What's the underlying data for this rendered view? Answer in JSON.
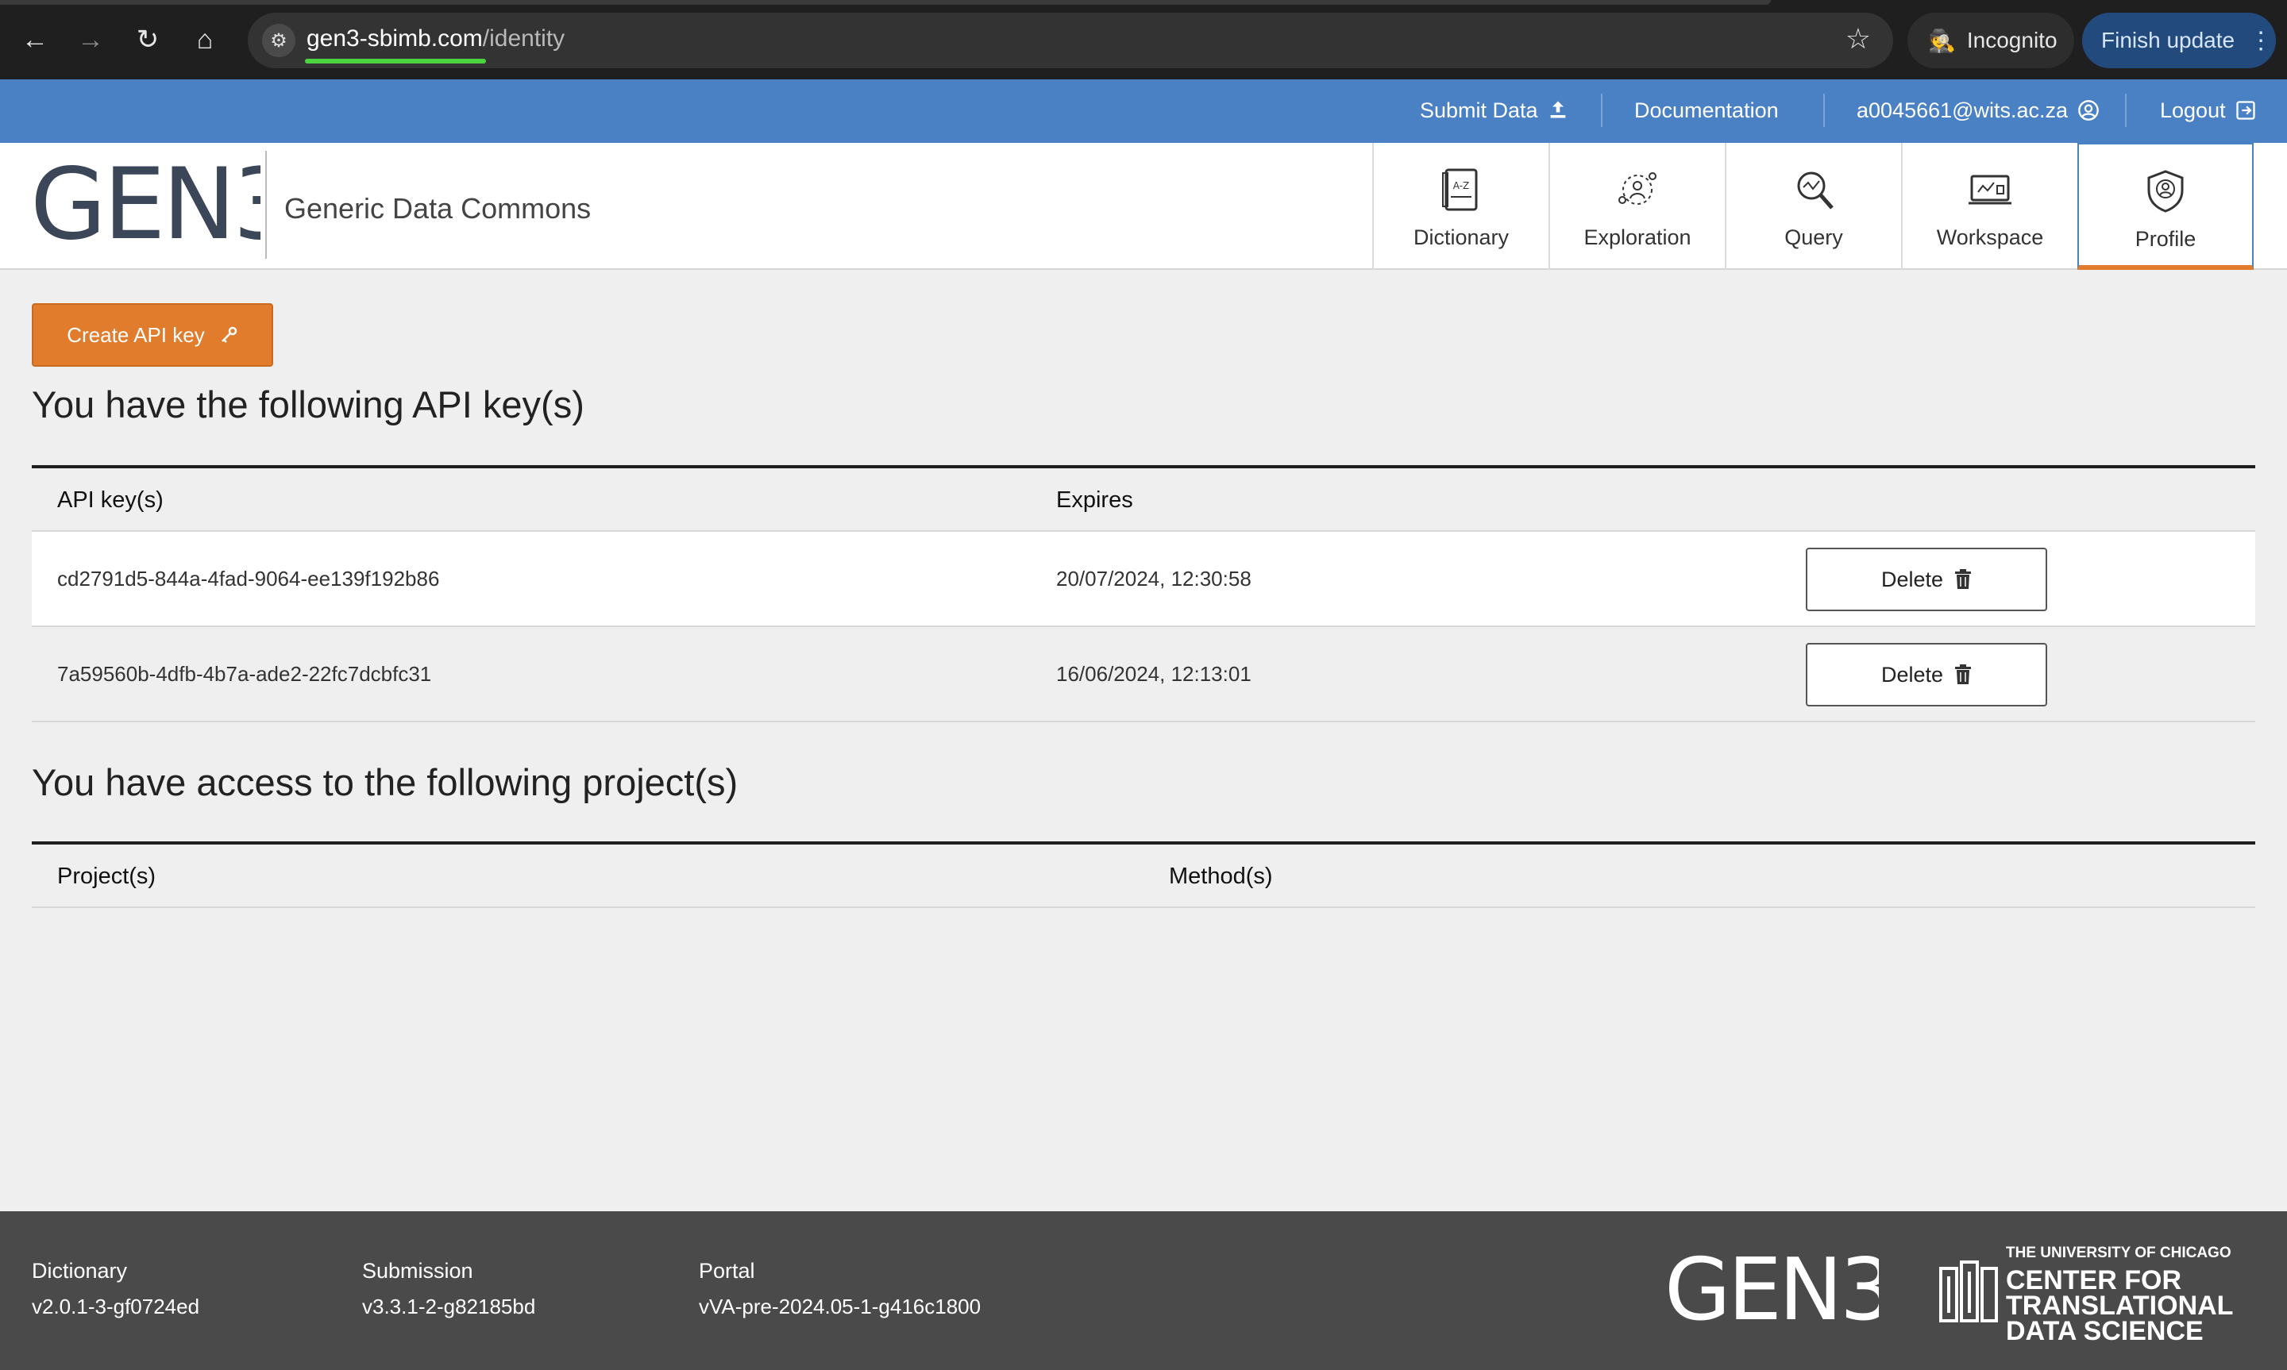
{
  "browser": {
    "url_host": "gen3-sbimb.com",
    "url_path": "/identity",
    "incognito_label": "Incognito",
    "finish_update_label": "Finish update",
    "icons": [
      "back-icon",
      "forward-icon",
      "reload-icon",
      "home-icon",
      "site-settings-icon",
      "star-icon",
      "incognito-icon",
      "more-icon"
    ]
  },
  "topbar": {
    "submit_data": "Submit Data",
    "documentation": "Documentation",
    "user_email": "a0045661@wits.ac.za",
    "logout": "Logout"
  },
  "header": {
    "logo_text": "GEN3",
    "subtitle": "Generic Data Commons",
    "dictionary_icon_text": "A-Z",
    "tabs": [
      {
        "label": "Dictionary",
        "icon": "dictionary-icon"
      },
      {
        "label": "Exploration",
        "icon": "exploration-icon"
      },
      {
        "label": "Query",
        "icon": "query-icon"
      },
      {
        "label": "Workspace",
        "icon": "workspace-icon"
      },
      {
        "label": "Profile",
        "icon": "profile-icon",
        "active": true
      }
    ]
  },
  "api_keys": {
    "create_label": "Create API key",
    "heading": "You have the following API key(s)",
    "col_key": "API key(s)",
    "col_expires": "Expires",
    "delete_label": "Delete",
    "rows": [
      {
        "key": "cd2791d5-844a-4fad-9064-ee139f192b86",
        "expires": "20/07/2024, 12:30:58"
      },
      {
        "key": "7a59560b-4dfb-4b7a-ade2-22fc7dcbfc31",
        "expires": "16/06/2024, 12:13:01"
      }
    ]
  },
  "projects": {
    "heading": "You have access to the following project(s)",
    "col_project": "Project(s)",
    "col_method": "Method(s)"
  },
  "footer": {
    "dictionary_title": "Dictionary",
    "dictionary_version": "v2.0.1-3-gf0724ed",
    "submission_title": "Submission",
    "submission_version": "v3.3.1-2-g82185bd",
    "portal_title": "Portal",
    "portal_version": "vVA-pre-2024.05-1-g416c1800",
    "logo_text": "GEN3",
    "ctds_line1": "THE UNIVERSITY OF CHICAGO",
    "ctds_line2": "CENTER FOR",
    "ctds_line3": "TRANSLATIONAL",
    "ctds_line4": "DATA SCIENCE"
  },
  "colors": {
    "topbar": "#4a81c4",
    "accent_orange": "#e07c2c",
    "footer": "#4a4a4a"
  }
}
